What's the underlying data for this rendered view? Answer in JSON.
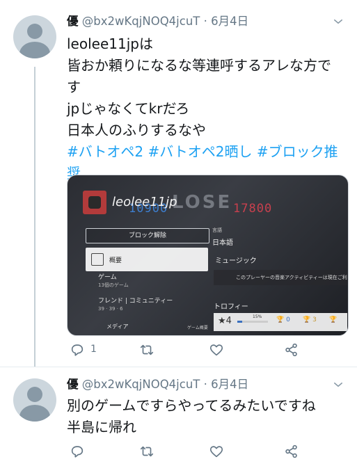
{
  "tweets": [
    {
      "display_name": "優",
      "handle": "@bx2wKqjNOQ4jcuT",
      "separator": "·",
      "date": "6月4日",
      "lines": [
        "leolee11jpは",
        "皆おか頼りになるな等連呼するアレな方で",
        "す",
        "jpじゃなくてkrだろ",
        "日本人のふりするなや"
      ],
      "hashtags_line1": "#バトオペ2 #バトオペ2晒し #ブロック推",
      "hashtags_line2": "奨",
      "reply_count": "1"
    },
    {
      "display_name": "優",
      "handle": "@bx2wKqjNOQ4jcuT",
      "separator": "·",
      "date": "6月4日",
      "lines": [
        "別のゲームですらやってるみたいですね",
        "半島に帰れ"
      ]
    }
  ],
  "media": {
    "score_left": "10900",
    "score_right": "17800",
    "background_word": "LOSE",
    "username": "leolee11jp",
    "block_button": "ブロック解除",
    "profile_label": "概要",
    "game_label": "ゲーム",
    "game_sub": "13個のゲーム",
    "friends_label": "フレンド | コミュニティー",
    "friends_sub": "39  ·  39  ·  6",
    "media_label": "メディア",
    "language_label": "言語",
    "language_value": "日本語",
    "music_label": "ミュージック",
    "activity_text": "このプレーヤーの音楽アクティビティーは現在ご利用",
    "trophy_label": "トロフィー",
    "trophy_level": "★4",
    "trophy_percent": "15%",
    "trophy_progress": 0.15,
    "trophy_silver": "0",
    "trophy_gold": "3",
    "game_list_label": "ゲーム概要"
  },
  "colors": {
    "link": "#1da1f2",
    "secondary_text": "#657786",
    "primary_text": "#14171a"
  },
  "icons": [
    "caret-down-icon",
    "reply-icon",
    "retweet-icon",
    "like-icon",
    "share-icon",
    "default-avatar-icon"
  ]
}
